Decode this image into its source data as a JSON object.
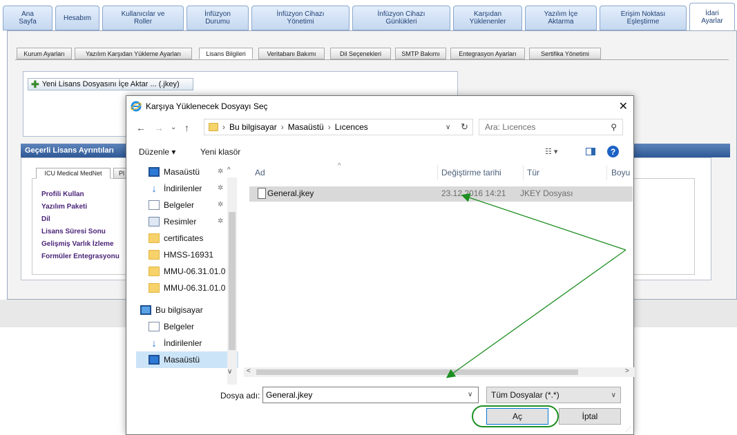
{
  "topnav": {
    "tabs": [
      {
        "label": "Ana\nSayfa"
      },
      {
        "label": "Hesabım"
      },
      {
        "label": "Kullanıcılar ve\nRoller"
      },
      {
        "label": "İnfüzyon\nDurumu"
      },
      {
        "label": "İnfüzyon Cihazı\nYönetimi"
      },
      {
        "label": "İnfüzyon Cihazı\nGünlükleri"
      },
      {
        "label": "Karşıdan\nYüklenenler"
      },
      {
        "label": "Yazılım İçe\nAktarma"
      },
      {
        "label": "Erişim Noktası\nEşleştirme"
      },
      {
        "label": "İdari\nAyarlar"
      }
    ]
  },
  "subtabs": [
    "Kurum Ayarları",
    "Yazılım Karşıdan Yükleme Ayarları",
    "Lisans Bilgileri",
    "Veritabanı Bakımı",
    "Dil Seçenekleri",
    "SMTP Bakımı",
    "Entegrasyon Ayarları",
    "Sertifika Yönetimi"
  ],
  "import_button": "Yeni Lisans Dosyasını İçe Aktar ... (.jkey)",
  "details": {
    "header": "Geçerli Lisans Ayrıntıları",
    "tabs": [
      "ICU Medical MedNet",
      "Pl"
    ],
    "labels": [
      "Profili Kullan",
      "Yazılım Paketi",
      "Dil",
      "Lisans Süresi Sonu",
      "Gelişmiş Varlık İzleme",
      "Formüler Entegrasyonu"
    ]
  },
  "dialog": {
    "title": "Karşıya Yüklenecek Dosyayı Seç",
    "close": "✕",
    "address": [
      "Bu bilgisayar",
      "Masaüstü",
      "Lıcences"
    ],
    "search_placeholder": "Ara: Lıcences",
    "organize": "Düzenle ▾",
    "new_folder": "Yeni klasör",
    "nav_items": [
      {
        "label": "Masaüstü",
        "icon": "desktop-icon"
      },
      {
        "label": "İndirilenler",
        "icon": "download-icon"
      },
      {
        "label": "Belgeler",
        "icon": "documents-icon"
      },
      {
        "label": "Resimler",
        "icon": "pictures-icon"
      },
      {
        "label": "certificates",
        "icon": "folder-icon"
      },
      {
        "label": "HMSS-16931",
        "icon": "folder-icon"
      },
      {
        "label": "MMU-06.31.01.0",
        "icon": "folder-icon"
      },
      {
        "label": "MMU-06.31.01.0",
        "icon": "folder-icon"
      },
      {
        "label": "Bu bilgisayar",
        "icon": "computer-icon"
      },
      {
        "label": "Belgeler",
        "icon": "documents-icon"
      },
      {
        "label": "İndirilenler",
        "icon": "download-icon"
      },
      {
        "label": "Masaüstü",
        "icon": "desktop-icon"
      }
    ],
    "columns": [
      "Ad",
      "Değiştirme tarihi",
      "Tür",
      "Boyu"
    ],
    "file": {
      "name": "General.jkey",
      "date": "23.12.2016 14:21",
      "type": "JKEY Dosyası"
    },
    "filename_label": "Dosya adı:",
    "filename_value": "General.jkey",
    "filetype": "Tüm Dosyalar (*.*)",
    "open": "Aç",
    "cancel": "İptal"
  },
  "colors": {
    "nav_active": "#ffffff",
    "header_blue": "#2d5996",
    "annotation_green": "#1d8f21",
    "selected_row": "#d9d9d9"
  }
}
